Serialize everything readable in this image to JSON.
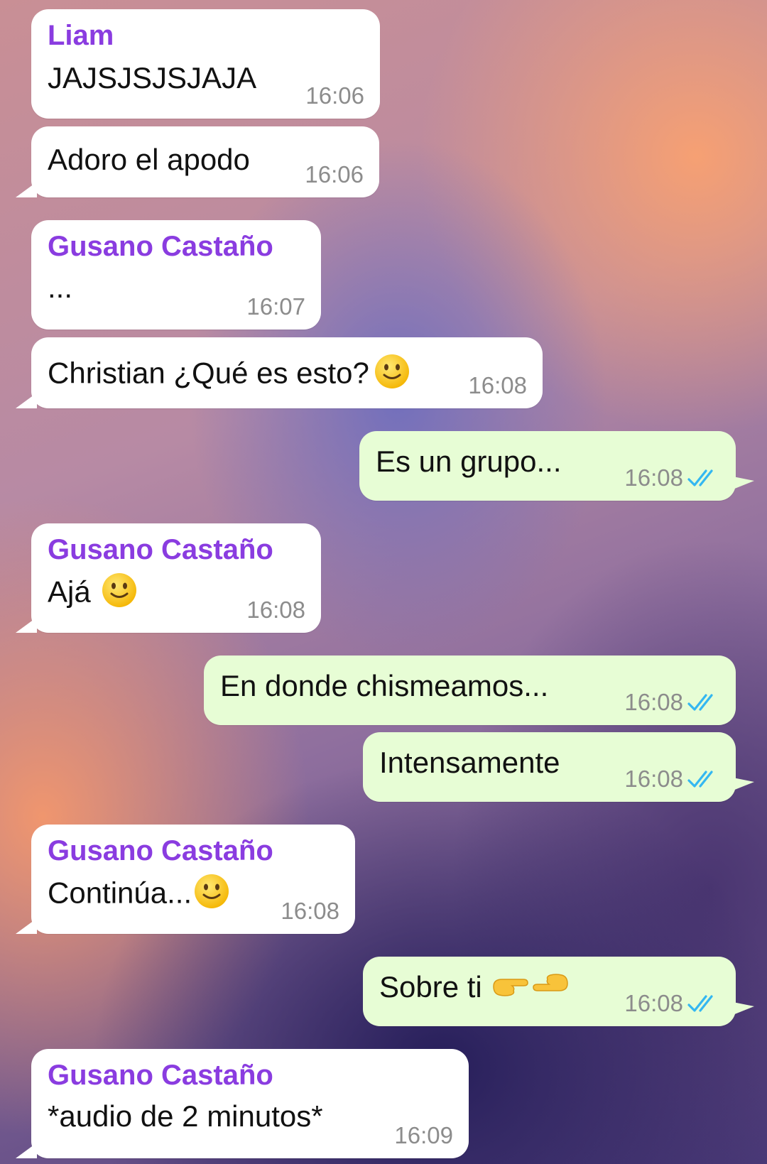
{
  "colors": {
    "incoming_bubble": "#ffffff",
    "outgoing_bubble": "#e7fdd5",
    "sender_name": "#8a3ce0",
    "read_ticks": "#34b7f1"
  },
  "messages": [
    {
      "direction": "incoming",
      "sender": "Liam",
      "text": "JAJSJSJSJAJA",
      "time": "16:06"
    },
    {
      "direction": "incoming",
      "text": "Adoro el apodo",
      "time": "16:06"
    },
    {
      "direction": "incoming",
      "sender": "Gusano Castaño",
      "text": "...",
      "time": "16:07"
    },
    {
      "direction": "incoming",
      "text": "Christian ¿Qué es esto?",
      "emoji": "slightly-smiling-face",
      "time": "16:08"
    },
    {
      "direction": "outgoing",
      "text": "Es un grupo...",
      "time": "16:08",
      "status": "read"
    },
    {
      "direction": "incoming",
      "sender": "Gusano Castaño",
      "text": "Ajá",
      "emoji": "slightly-smiling-face",
      "time": "16:08"
    },
    {
      "direction": "outgoing",
      "text": "En donde chismeamos...",
      "time": "16:08",
      "status": "read"
    },
    {
      "direction": "outgoing",
      "text": "Intensamente",
      "time": "16:08",
      "status": "read"
    },
    {
      "direction": "incoming",
      "sender": "Gusano Castaño",
      "text": "Continúa...",
      "emoji": "slightly-smiling-face",
      "time": "16:08"
    },
    {
      "direction": "outgoing",
      "text": "Sobre ti",
      "emoji": "pointing-fingers-together",
      "time": "16:08",
      "status": "read"
    },
    {
      "direction": "incoming",
      "sender": "Gusano Castaño",
      "text": "*audio de 2 minutos*",
      "time": "16:09"
    }
  ]
}
